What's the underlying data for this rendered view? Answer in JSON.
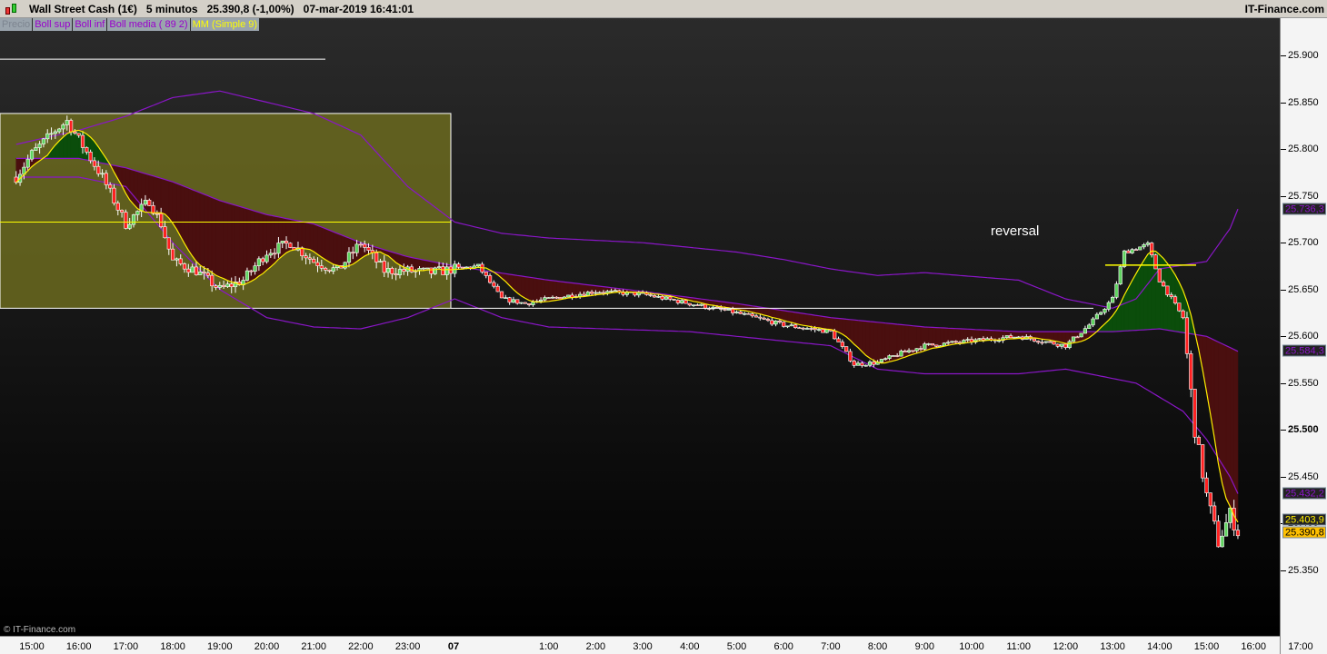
{
  "header": {
    "instrument": "Wall Street Cash (1€)",
    "timeframe": "5 minutos",
    "price": "25.390,8 (-1,00%)",
    "datetime": "07-mar-2019 16:41:01",
    "brand": "IT-Finance.com"
  },
  "legend": [
    {
      "label": "Precio",
      "color": "#7d8590"
    },
    {
      "label": "Boll sup",
      "color": "#9900cc"
    },
    {
      "label": "Boll inf",
      "color": "#9900cc"
    },
    {
      "label": "Boll media ( 89 2)",
      "color": "#9900cc"
    },
    {
      "label": "MM (Simple 9)",
      "color": "#ffff00"
    }
  ],
  "annotation": "reversal",
  "copyright": "© IT-Finance.com",
  "colors": {
    "up": "#5fd35f",
    "down": "#ff2020",
    "boll": "#8a16c8",
    "mm": "#ffee00",
    "fill_up": "#0b4d0b",
    "fill_down": "#4a0f0f",
    "box": "#6b6a1f"
  },
  "chart_data": {
    "type": "candlestick",
    "ylim": [
      25330,
      25930
    ],
    "y_ticks": [
      "25.900",
      "25.850",
      "25.800",
      "25.750",
      "25.700",
      "25.650",
      "25.600",
      "25.550",
      "25.500",
      "25.450",
      "25.400",
      "25.350"
    ],
    "x_ticks": [
      "15:00",
      "16:00",
      "17:00",
      "18:00",
      "19:00",
      "20:00",
      "21:00",
      "22:00",
      "23:00",
      "07",
      "1:00",
      "2:00",
      "3:00",
      "4:00",
      "5:00",
      "6:00",
      "7:00",
      "8:00",
      "9:00",
      "10:00",
      "11:00",
      "12:00",
      "13:00",
      "14:00",
      "15:00",
      "16:00",
      "17:00"
    ],
    "price_path": [
      [
        "14:40",
        25770
      ],
      [
        "15:00",
        25795
      ],
      [
        "15:30",
        25820
      ],
      [
        "15:45",
        25830
      ],
      [
        "16:00",
        25810
      ],
      [
        "16:15",
        25790
      ],
      [
        "16:30",
        25770
      ],
      [
        "17:00",
        25720
      ],
      [
        "17:30",
        25745
      ],
      [
        "17:45",
        25720
      ],
      [
        "18:00",
        25680
      ],
      [
        "18:30",
        25670
      ],
      [
        "19:00",
        25650
      ],
      [
        "19:30",
        25660
      ],
      [
        "20:00",
        25690
      ],
      [
        "20:30",
        25700
      ],
      [
        "21:00",
        25680
      ],
      [
        "21:30",
        25670
      ],
      [
        "22:00",
        25700
      ],
      [
        "22:30",
        25670
      ],
      [
        "23:00",
        25670
      ],
      [
        "23:30",
        25668
      ],
      [
        "00:00",
        25672
      ],
      [
        "00:30",
        25675
      ],
      [
        "01:00",
        25640
      ],
      [
        "01:30",
        25635
      ],
      [
        "02:00",
        25640
      ],
      [
        "03:00",
        25648
      ],
      [
        "04:00",
        25645
      ],
      [
        "05:00",
        25635
      ],
      [
        "06:00",
        25625
      ],
      [
        "07:00",
        25612
      ],
      [
        "08:00",
        25605
      ],
      [
        "08:30",
        25570
      ],
      [
        "09:00",
        25572
      ],
      [
        "09:30",
        25582
      ],
      [
        "10:00",
        25590
      ],
      [
        "11:00",
        25595
      ],
      [
        "12:00",
        25600
      ],
      [
        "13:00",
        25590
      ],
      [
        "13:30",
        25612
      ],
      [
        "14:00",
        25640
      ],
      [
        "14:15",
        25690
      ],
      [
        "14:45",
        25698
      ],
      [
        "15:00",
        25660
      ],
      [
        "15:30",
        25620
      ],
      [
        "15:45",
        25500
      ],
      [
        "16:00",
        25430
      ],
      [
        "16:15",
        25380
      ],
      [
        "16:30",
        25410
      ],
      [
        "16:40",
        25391
      ]
    ],
    "boll_sup": [
      [
        "14:40",
        25805
      ],
      [
        "16:00",
        25820
      ],
      [
        "17:00",
        25835
      ],
      [
        "18:00",
        25855
      ],
      [
        "19:00",
        25862
      ],
      [
        "20:00",
        25850
      ],
      [
        "21:00",
        25838
      ],
      [
        "22:00",
        25815
      ],
      [
        "23:00",
        25760
      ],
      [
        "00:00",
        25722
      ],
      [
        "01:00",
        25710
      ],
      [
        "02:00",
        25705
      ],
      [
        "04:00",
        25700
      ],
      [
        "06:00",
        25690
      ],
      [
        "07:00",
        25682
      ],
      [
        "08:00",
        25672
      ],
      [
        "09:00",
        25665
      ],
      [
        "10:00",
        25668
      ],
      [
        "12:00",
        25660
      ],
      [
        "13:00",
        25640
      ],
      [
        "14:00",
        25630
      ],
      [
        "14:30",
        25640
      ],
      [
        "15:00",
        25672
      ],
      [
        "16:00",
        25680
      ],
      [
        "16:30",
        25715
      ],
      [
        "16:40",
        25736
      ]
    ],
    "boll_inf": [
      [
        "14:40",
        25770
      ],
      [
        "16:00",
        25770
      ],
      [
        "17:00",
        25760
      ],
      [
        "18:00",
        25700
      ],
      [
        "19:00",
        25650
      ],
      [
        "20:00",
        25620
      ],
      [
        "21:00",
        25610
      ],
      [
        "22:00",
        25608
      ],
      [
        "23:00",
        25620
      ],
      [
        "00:00",
        25640
      ],
      [
        "01:00",
        25620
      ],
      [
        "02:00",
        25610
      ],
      [
        "05:00",
        25605
      ],
      [
        "07:00",
        25595
      ],
      [
        "08:00",
        25590
      ],
      [
        "09:00",
        25565
      ],
      [
        "10:00",
        25560
      ],
      [
        "12:00",
        25560
      ],
      [
        "13:00",
        25565
      ],
      [
        "14:00",
        25555
      ],
      [
        "14:30",
        25550
      ],
      [
        "15:00",
        25535
      ],
      [
        "15:30",
        25520
      ],
      [
        "16:00",
        25490
      ],
      [
        "16:30",
        25450
      ],
      [
        "16:40",
        25432
      ]
    ],
    "boll_media": [
      [
        "14:40",
        25790
      ],
      [
        "16:00",
        25790
      ],
      [
        "17:00",
        25780
      ],
      [
        "18:00",
        25765
      ],
      [
        "19:00",
        25745
      ],
      [
        "20:00",
        25730
      ],
      [
        "21:00",
        25720
      ],
      [
        "22:00",
        25700
      ],
      [
        "23:00",
        25685
      ],
      [
        "00:00",
        25675
      ],
      [
        "02:00",
        25660
      ],
      [
        "04:00",
        25648
      ],
      [
        "06:00",
        25635
      ],
      [
        "08:00",
        25620
      ],
      [
        "10:00",
        25610
      ],
      [
        "12:00",
        25605
      ],
      [
        "14:00",
        25605
      ],
      [
        "15:00",
        25608
      ],
      [
        "16:00",
        25600
      ],
      [
        "16:40",
        25584
      ]
    ],
    "mm_period": 9,
    "last_values": {
      "boll_sup": "25.736,3",
      "boll_media": "25.584,3",
      "boll_inf": "25.432,2",
      "mm": "25.403,9",
      "price": "25.390,8"
    },
    "drawings": {
      "box": {
        "from": "14:35",
        "to": "00:00",
        "top": 25838,
        "bottom": 25630
      },
      "box_midline": 25722,
      "top_line": {
        "from": "14:35",
        "to": "21:30",
        "price": 25896
      },
      "support_line": {
        "from": "00:00",
        "to": "13:45",
        "price": 25630
      },
      "reversal_line": {
        "from": "14:00",
        "to": "15:55",
        "price": 25676
      }
    }
  }
}
